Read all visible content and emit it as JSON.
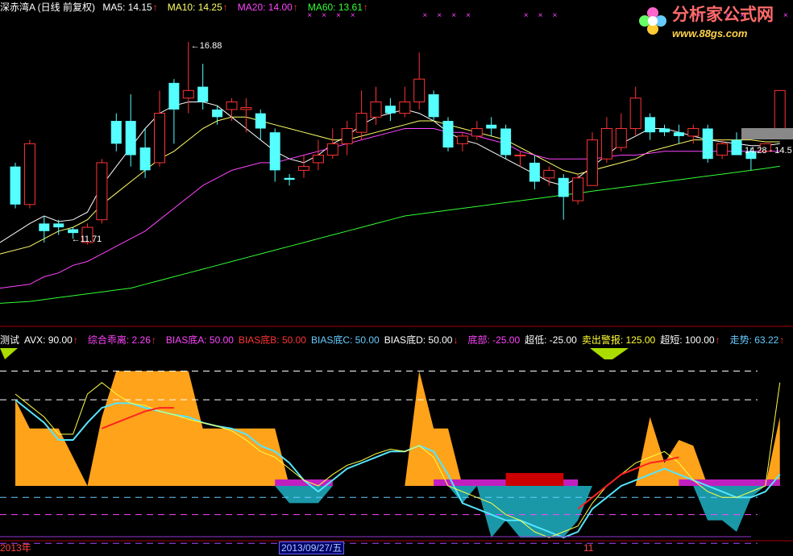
{
  "top_legend": {
    "title": "深赤湾A (日线 前复权)",
    "items": [
      {
        "text": "MA5: 14.15",
        "color": "#ffffff",
        "arrow": "↑"
      },
      {
        "text": "MA10: 14.25",
        "color": "#ffff66",
        "arrow": "↑"
      },
      {
        "text": "MA20: 14.00",
        "color": "#ff44ff",
        "arrow": "↑"
      },
      {
        "text": "MA60: 13.61",
        "color": "#33ff33",
        "arrow": "↑"
      }
    ],
    "arrow_color": "#ff3333"
  },
  "logo": {
    "title": "分析家公式网",
    "url": "www.88gs.com"
  },
  "bottom_legend": {
    "items": [
      {
        "text": "测试",
        "color": "#ffffff",
        "arrow": ""
      },
      {
        "text": "AVX: 90.00",
        "color": "#ffffff",
        "arrow": "↑"
      },
      {
        "text": "综合乖离: 2.26",
        "color": "#ff44ff",
        "arrow": "↑"
      },
      {
        "text": "BIAS底A: 50.00",
        "color": "#ff44ff",
        "arrow": ""
      },
      {
        "text": "BIAS底B: 50.00",
        "color": "#ff3333",
        "arrow": ""
      },
      {
        "text": "BIAS底C: 50.00",
        "color": "#66ccff",
        "arrow": ""
      },
      {
        "text": "BIAS底D: 50.00",
        "color": "#ffffff",
        "arrow": "↓"
      },
      {
        "text": "底部: -25.00",
        "color": "#ff44ff",
        "arrow": ""
      },
      {
        "text": "超低: -25.00",
        "color": "#ffffff",
        "arrow": ""
      },
      {
        "text": "卖出警报: 125.00",
        "color": "#ffff33",
        "arrow": ""
      },
      {
        "text": "超短: 100.00",
        "color": "#ffffff",
        "arrow": "↑"
      },
      {
        "text": "走势: 63.22",
        "color": "#66ccff",
        "arrow": "↑"
      }
    ],
    "arrow_color": "#ff3333"
  },
  "x_axis": {
    "labels": [
      "2013年",
      "2013/09/27/五",
      "11"
    ]
  },
  "chart_data": [
    {
      "type": "candlestick",
      "title": "深赤湾A (日线 前复权)",
      "y_range": [
        9.5,
        17.6
      ],
      "annotations": [
        {
          "text": "16.88",
          "value": 16.88
        },
        {
          "text": "11.71",
          "value": 11.71
        }
      ],
      "right_label": "14.28 - 14.5",
      "candles": [
        [
          13.6,
          12.6,
          12.5,
          13.7
        ],
        [
          12.6,
          14.2,
          12.5,
          14.3
        ],
        [
          12.1,
          11.9,
          11.6,
          12.3
        ],
        [
          12.1,
          12.0,
          11.8,
          12.2
        ],
        [
          11.95,
          11.85,
          11.7,
          12.0
        ],
        [
          11.6,
          12.0,
          11.55,
          12.1
        ],
        [
          12.2,
          13.7,
          12.1,
          13.8
        ],
        [
          14.8,
          14.2,
          14.0,
          15.0
        ],
        [
          14.8,
          13.9,
          13.6,
          15.5
        ],
        [
          14.1,
          13.5,
          13.3,
          14.6
        ],
        [
          13.7,
          15.0,
          13.6,
          15.6
        ],
        [
          15.8,
          15.1,
          14.2,
          15.9
        ],
        [
          15.4,
          15.6,
          15.0,
          16.88
        ],
        [
          15.7,
          15.3,
          15.1,
          16.3
        ],
        [
          15.1,
          14.9,
          14.7,
          15.2
        ],
        [
          15.1,
          15.3,
          14.8,
          15.4
        ],
        [
          15.1,
          15.15,
          14.5,
          15.4
        ],
        [
          15.0,
          14.6,
          14.3,
          15.1
        ],
        [
          14.5,
          13.5,
          13.2,
          14.6
        ],
        [
          13.3,
          13.25,
          13.1,
          13.4
        ],
        [
          13.5,
          13.6,
          13.3,
          13.9
        ],
        [
          13.7,
          13.9,
          13.5,
          14.3
        ],
        [
          13.9,
          14.2,
          13.8,
          14.6
        ],
        [
          14.2,
          14.6,
          13.9,
          14.8
        ],
        [
          14.5,
          15.0,
          14.3,
          15.6
        ],
        [
          14.9,
          15.3,
          14.7,
          15.7
        ],
        [
          15.2,
          15.0,
          14.8,
          15.4
        ],
        [
          15.0,
          15.3,
          14.9,
          15.7
        ],
        [
          15.3,
          15.9,
          15.1,
          16.6
        ],
        [
          15.5,
          14.9,
          14.8,
          15.6
        ],
        [
          14.8,
          14.1,
          14.0,
          14.9
        ],
        [
          14.2,
          14.4,
          14.0,
          14.5
        ],
        [
          14.4,
          14.6,
          14.3,
          14.8
        ],
        [
          14.7,
          14.6,
          14.4,
          14.9
        ],
        [
          14.6,
          13.9,
          13.8,
          14.7
        ],
        [
          13.9,
          13.9,
          13.6,
          14.0
        ],
        [
          13.7,
          13.2,
          13.0,
          13.9
        ],
        [
          13.3,
          13.5,
          13.1,
          13.6
        ],
        [
          13.3,
          12.8,
          12.2,
          13.4
        ],
        [
          12.7,
          13.3,
          12.6,
          13.4
        ],
        [
          13.1,
          14.3,
          13.1,
          14.5
        ],
        [
          13.8,
          14.6,
          13.7,
          14.9
        ],
        [
          14.1,
          14.6,
          14.0,
          15.0
        ],
        [
          14.6,
          15.4,
          14.4,
          15.7
        ],
        [
          14.9,
          14.5,
          14.3,
          15.0
        ],
        [
          14.6,
          14.5,
          14.4,
          14.7
        ],
        [
          14.5,
          14.4,
          14.2,
          14.7
        ],
        [
          14.4,
          14.6,
          14.2,
          14.7
        ],
        [
          14.6,
          13.8,
          13.7,
          14.7
        ],
        [
          13.9,
          14.2,
          13.8,
          14.3
        ],
        [
          14.3,
          13.9,
          13.9,
          14.5
        ],
        [
          14.0,
          13.8,
          13.5,
          14.1
        ],
        [
          14.0,
          14.2,
          14.0,
          14.2
        ],
        [
          14.5,
          15.6,
          14.5,
          15.6
        ]
      ],
      "ma_series": [
        {
          "name": "MA5",
          "color": "#ffffff",
          "values": [
            11.6,
            12.1,
            12.3,
            12.15,
            12.2,
            12.4,
            13.1,
            13.6,
            14.1,
            14.6,
            15.0,
            15.2,
            15.3,
            15.3,
            15.2,
            14.9,
            14.6,
            14.3,
            14.0,
            13.8,
            13.7,
            13.9,
            14.2,
            14.4,
            14.7,
            14.9,
            15.0,
            15.1,
            15.0,
            14.8,
            14.5,
            14.3,
            14.2,
            14.0,
            13.8,
            13.6,
            13.4,
            13.2,
            13.1,
            13.3,
            13.6,
            13.9,
            14.2,
            14.4,
            14.6,
            14.6,
            14.5,
            14.4,
            14.3,
            14.25,
            14.2,
            14.15,
            14.15,
            14.2
          ]
        },
        {
          "name": "MA10",
          "color": "#ffff66",
          "values": [
            11.3,
            11.5,
            11.7,
            11.9,
            12.0,
            12.2,
            12.6,
            12.9,
            13.2,
            13.5,
            13.8,
            14.0,
            14.3,
            14.6,
            14.8,
            14.9,
            14.9,
            14.8,
            14.7,
            14.6,
            14.5,
            14.4,
            14.3,
            14.3,
            14.4,
            14.5,
            14.6,
            14.7,
            14.8,
            14.8,
            14.7,
            14.6,
            14.5,
            14.4,
            14.3,
            14.1,
            13.9,
            13.7,
            13.5,
            13.4,
            13.5,
            13.6,
            13.7,
            13.8,
            14.0,
            14.1,
            14.2,
            14.3,
            14.3,
            14.3,
            14.3,
            14.3,
            14.25,
            14.25
          ]
        },
        {
          "name": "MA20",
          "color": "#ff44ff",
          "values": [
            10.4,
            10.5,
            10.7,
            10.8,
            11.0,
            11.1,
            11.3,
            11.5,
            11.7,
            11.9,
            12.2,
            12.5,
            12.8,
            13.1,
            13.3,
            13.5,
            13.6,
            13.7,
            13.7,
            13.8,
            13.9,
            14.0,
            14.1,
            14.2,
            14.3,
            14.4,
            14.5,
            14.6,
            14.6,
            14.6,
            14.5,
            14.5,
            14.4,
            14.3,
            14.2,
            14.0,
            13.9,
            13.8,
            13.8,
            13.8,
            13.8,
            13.85,
            13.9,
            13.9,
            13.95,
            14.0,
            14.0,
            14.0,
            14.0,
            14.0,
            14.0,
            14.0,
            14.0,
            14.0
          ]
        },
        {
          "name": "MA60",
          "color": "#33ff33",
          "values": [
            10.0,
            10.05,
            10.1,
            10.15,
            10.2,
            10.25,
            10.3,
            10.35,
            10.4,
            10.5,
            10.6,
            10.7,
            10.8,
            10.9,
            11.0,
            11.1,
            11.2,
            11.3,
            11.4,
            11.5,
            11.6,
            11.7,
            11.8,
            11.9,
            12.0,
            12.1,
            12.2,
            12.3,
            12.35,
            12.4,
            12.45,
            12.5,
            12.55,
            12.6,
            12.65,
            12.7,
            12.75,
            12.8,
            12.85,
            12.9,
            12.95,
            13.0,
            13.05,
            13.1,
            13.15,
            13.2,
            13.25,
            13.3,
            13.35,
            13.4,
            13.45,
            13.5,
            13.55,
            13.61
          ]
        }
      ]
    },
    {
      "type": "area",
      "title": "测试",
      "y_range": [
        -40,
        120
      ],
      "levels": [
        {
          "value": 100,
          "color": "#ffffff"
        },
        {
          "value": 75,
          "color": "#ffffff"
        },
        {
          "value": -10,
          "color": "#66ccff"
        },
        {
          "value": -25,
          "color": "#ff44ff"
        },
        {
          "value": -50,
          "color": "#aa44ff"
        }
      ],
      "orange_area": [
        75,
        50,
        50,
        50,
        25,
        0,
        60,
        100,
        100,
        100,
        100,
        100,
        100,
        50,
        50,
        50,
        50,
        50,
        50,
        0,
        0,
        0,
        0,
        0,
        0,
        0,
        0,
        0,
        100,
        50,
        50,
        0,
        0,
        0,
        0,
        0,
        0,
        0,
        0,
        0,
        0,
        0,
        0,
        0,
        60,
        20,
        40,
        35,
        0,
        0,
        0,
        0,
        0,
        60
      ],
      "teal_area": [
        0,
        0,
        0,
        0,
        0,
        0,
        0,
        0,
        0,
        0,
        0,
        0,
        0,
        0,
        0,
        0,
        0,
        0,
        0,
        -15,
        -15,
        -15,
        0,
        0,
        0,
        0,
        0,
        0,
        0,
        0,
        0,
        -15,
        0,
        -45,
        -30,
        -45,
        -45,
        -45,
        -45,
        -30,
        0,
        0,
        0,
        0,
        0,
        0,
        0,
        0,
        -30,
        -30,
        -40,
        -10,
        0,
        0
      ],
      "lines": [
        {
          "name": "cyan",
          "color": "#55e5ff",
          "values": [
            75,
            65,
            55,
            40,
            40,
            55,
            68,
            72,
            72,
            68,
            65,
            62,
            60,
            55,
            52,
            50,
            45,
            35,
            30,
            20,
            5,
            -5,
            5,
            15,
            20,
            25,
            30,
            30,
            35,
            30,
            10,
            -15,
            -20,
            -25,
            -30,
            -30,
            -35,
            -40,
            -45,
            -40,
            -20,
            -10,
            0,
            5,
            10,
            15,
            10,
            5,
            0,
            -5,
            -10,
            -10,
            -5,
            10
          ]
        },
        {
          "name": "yellow",
          "color": "#ffff44",
          "values": [
            80,
            70,
            60,
            45,
            45,
            80,
            90,
            80,
            72,
            70,
            65,
            62,
            58,
            55,
            52,
            48,
            40,
            30,
            25,
            15,
            5,
            0,
            10,
            18,
            22,
            28,
            32,
            30,
            35,
            25,
            0,
            -5,
            -10,
            -15,
            -25,
            -30,
            -40,
            -45,
            -40,
            -35,
            -15,
            0,
            10,
            20,
            25,
            30,
            20,
            5,
            -5,
            -10,
            -10,
            -5,
            0,
            90
          ]
        },
        {
          "name": "red",
          "color": "#ff2222",
          "values": [
            null,
            null,
            null,
            null,
            null,
            null,
            50,
            55,
            60,
            65,
            68,
            68,
            null,
            null,
            null,
            null,
            null,
            null,
            null,
            null,
            null,
            null,
            null,
            null,
            null,
            null,
            null,
            null,
            null,
            null,
            null,
            null,
            null,
            null,
            null,
            null,
            null,
            null,
            null,
            -20,
            -10,
            0,
            10,
            15,
            20,
            22,
            25,
            null,
            null,
            null,
            null,
            null,
            null,
            10
          ]
        }
      ]
    }
  ]
}
